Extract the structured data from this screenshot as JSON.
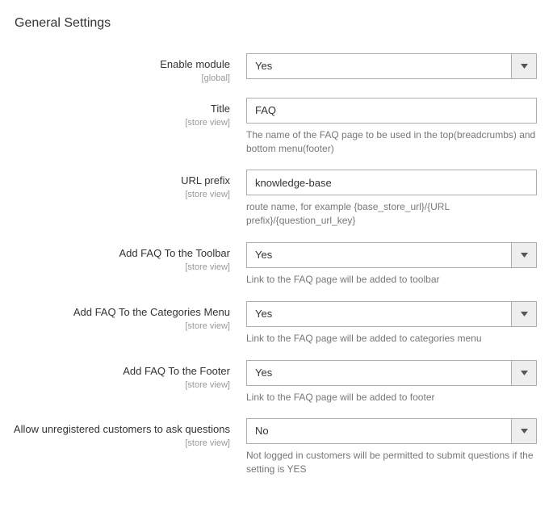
{
  "section": {
    "title": "General Settings"
  },
  "scopes": {
    "global": "[global]",
    "store_view": "[store view]"
  },
  "fields": {
    "enable_module": {
      "label": "Enable module",
      "value": "Yes"
    },
    "title": {
      "label": "Title",
      "value": "FAQ",
      "hint": "The name of the FAQ page to be used in the top(breadcrumbs) and bottom menu(footer)"
    },
    "url_prefix": {
      "label": "URL prefix",
      "value": "knowledge-base",
      "hint": "route name, for example {base_store_url}/{URL prefix}/{question_url_key}"
    },
    "add_toolbar": {
      "label": "Add FAQ To the Toolbar",
      "value": "Yes",
      "hint": "Link to the FAQ page will be added to toolbar"
    },
    "add_categories": {
      "label": "Add FAQ To the Categories Menu",
      "value": "Yes",
      "hint": "Link to the FAQ page will be added to categories menu"
    },
    "add_footer": {
      "label": "Add FAQ To the Footer",
      "value": "Yes",
      "hint": "Link to the FAQ page will be added to footer"
    },
    "allow_unregistered": {
      "label": "Allow unregistered customers to ask questions",
      "value": "No",
      "hint": "Not logged in customers will be permitted to submit questions if the setting is YES"
    }
  }
}
